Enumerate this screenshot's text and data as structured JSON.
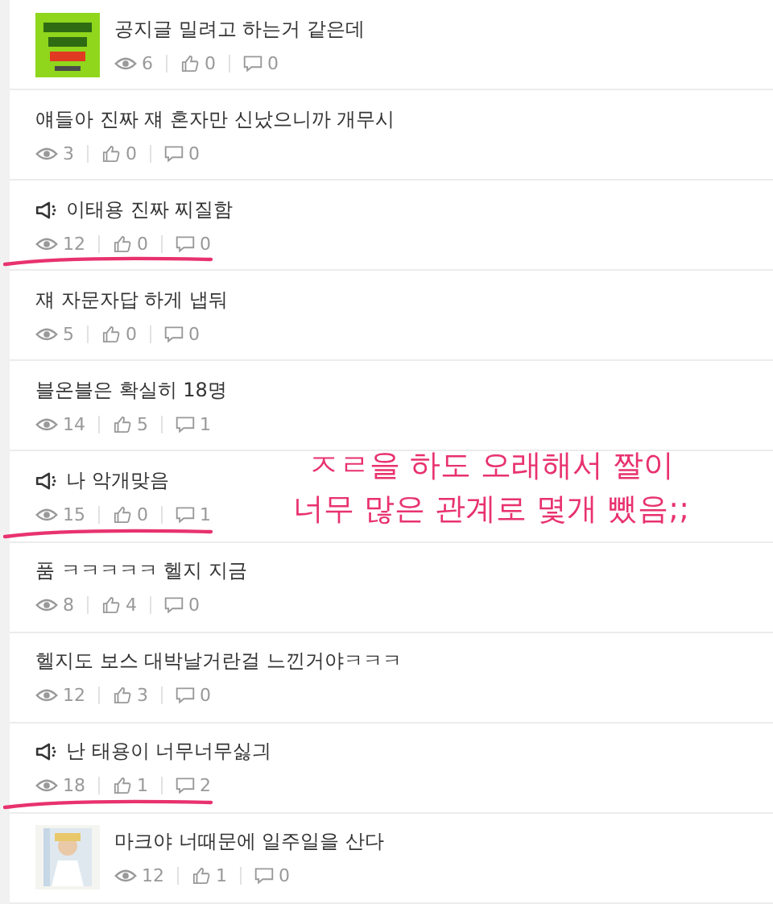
{
  "posts": [
    {
      "kind": "thumbnail",
      "title": "공지글 밀려고 하는거 같은데",
      "views": "6",
      "likes": "0",
      "comments": "0",
      "underlined": false
    },
    {
      "kind": "text",
      "title": "얘들아 진짜 쟤 혼자만 신났으니까 개무시",
      "views": "3",
      "likes": "0",
      "comments": "0",
      "underlined": false
    },
    {
      "kind": "notice",
      "title": "이태용 진짜 찌질함",
      "views": "12",
      "likes": "0",
      "comments": "0",
      "underlined": true
    },
    {
      "kind": "text",
      "title": "쟤 자문자답 하게 냅둬",
      "views": "5",
      "likes": "0",
      "comments": "0",
      "underlined": false
    },
    {
      "kind": "text",
      "title": "블온블은 확실히 18명",
      "views": "14",
      "likes": "5",
      "comments": "1",
      "underlined": false
    },
    {
      "kind": "notice",
      "title": "나 악개맞음",
      "views": "15",
      "likes": "0",
      "comments": "1",
      "underlined": true
    },
    {
      "kind": "text",
      "title": "품 ㅋㅋㅋㅋㅋ 헬지 지금",
      "views": "8",
      "likes": "4",
      "comments": "0",
      "underlined": false
    },
    {
      "kind": "text",
      "title": "헬지도 보스 대박날거란걸 느낀거야ㅋㅋㅋ",
      "views": "12",
      "likes": "3",
      "comments": "0",
      "underlined": false
    },
    {
      "kind": "notice",
      "title": "난 태용이 너무너무싫긔",
      "views": "18",
      "likes": "1",
      "comments": "2",
      "underlined": true
    },
    {
      "kind": "thumbnail",
      "title": "마크야 너때문에 일주일을 산다",
      "views": "12",
      "likes": "1",
      "comments": "0",
      "underlined": false
    }
  ],
  "annotation": {
    "lines": [
      "ㅈㄹ을 하도 오래해서 짤이",
      "너무 많은 관계로 몇개 뺐음;;"
    ]
  }
}
